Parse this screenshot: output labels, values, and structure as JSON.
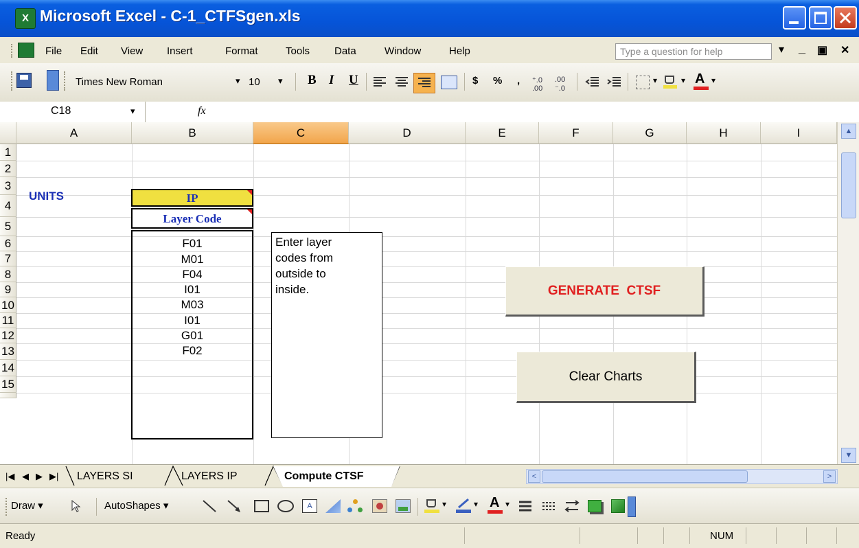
{
  "window": {
    "title": "Microsoft Excel - C-1_CTFSgen.xls",
    "app_icon_glyph": "X"
  },
  "menu": {
    "items": [
      "File",
      "Edit",
      "View",
      "Insert",
      "Format",
      "Tools",
      "Data",
      "Window",
      "Help"
    ],
    "help_placeholder": "Type a question for help"
  },
  "toolbar": {
    "font_name": "Times New Roman",
    "font_size": "10",
    "bold": "B",
    "italic": "I",
    "underline": "U",
    "currency": "$",
    "percent": "%",
    "comma": ","
  },
  "formula_bar": {
    "name_box": "C18",
    "fx": "fx",
    "content": ""
  },
  "grid": {
    "columns": [
      "A",
      "B",
      "C",
      "D",
      "E",
      "F",
      "G",
      "H",
      "I"
    ],
    "selected_column": "C",
    "rows": [
      "1",
      "2",
      "3",
      "4",
      "5",
      "6",
      "7",
      "8",
      "9",
      "10",
      "11",
      "12",
      "13",
      "14",
      "15"
    ],
    "units_label": "UNITS",
    "units_value": "IP",
    "layer_code_header": "Layer Code",
    "layer_codes": [
      "F01",
      "M01",
      "F04",
      "I01",
      "M03",
      "I01",
      "G01",
      "F02"
    ],
    "note": [
      "Enter layer",
      "codes from",
      "outside to",
      "inside."
    ]
  },
  "buttons": {
    "generate": "GENERATE  CTSF",
    "clear": "Clear Charts"
  },
  "sheet_tabs": {
    "tabs": [
      "LAYERS SI",
      "LAYERS IP",
      "Compute CTSF"
    ],
    "active": "Compute CTSF"
  },
  "draw_toolbar": {
    "draw": "Draw",
    "autoshapes": "AutoShapes"
  },
  "status": {
    "ready": "Ready",
    "num": "NUM"
  },
  "colors": {
    "units_label": "#1a2fb5",
    "ip_fill": "#f0e040",
    "generate_text": "#e02020",
    "selected_header": "#f2a64c",
    "title_bar": "#0a5fe0"
  }
}
